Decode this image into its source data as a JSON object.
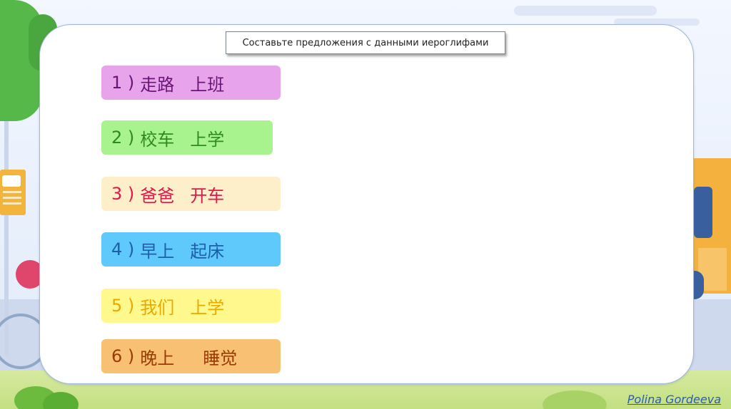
{
  "slide": {
    "title": "Составьте предложения с данными иероглифами",
    "author": "Polina Gordeeva"
  },
  "items": [
    {
      "num": "1 )",
      "w1": "走路",
      "w2": "上班",
      "bg": "#e8a4ea",
      "color": "#6a1478"
    },
    {
      "num": "2 )",
      "w1": "校车",
      "w2": "上学",
      "bg": "#a8f38d",
      "color": "#2f8a1c"
    },
    {
      "num": "3 )",
      "w1": "爸爸",
      "w2": "开车",
      "bg": "#fdefc9",
      "color": "#e2164a"
    },
    {
      "num": "4 )",
      "w1": "早上",
      "w2": "起床",
      "bg": "#5ec9fa",
      "color": "#1f5ea8"
    },
    {
      "num": "5 )",
      "w1": "我们",
      "w2": "上学",
      "bg": "#fff88c",
      "color": "#e8a900"
    },
    {
      "num": "6 )",
      "w1": "晚上",
      "w2": "睡觉",
      "bg": "#f8c073",
      "color": "#9a3b06"
    }
  ],
  "colors": {
    "card_border": "#9fb6de",
    "author_link": "#2a5db0"
  }
}
